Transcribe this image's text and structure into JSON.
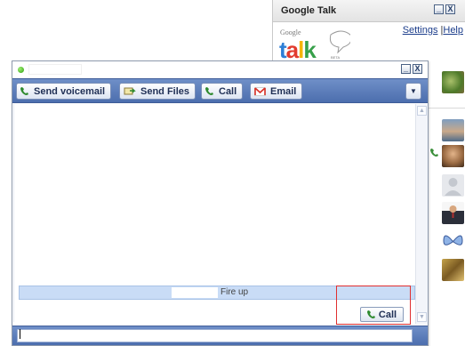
{
  "gtalk": {
    "title": "Google Talk",
    "settings_link": "Settings",
    "link_separator": " |",
    "help_link": "Help",
    "logo_text_google": "Google",
    "logo_text_talk": "talk",
    "logo_badge": "BETA",
    "accent": "#4c6eae"
  },
  "chat": {
    "toolbar": {
      "voicemail_label": "Send voicemail",
      "files_label": "Send Files",
      "call_label": "Call",
      "email_label": "Email",
      "menu_glyph": "▼"
    },
    "status_text": "Fire up",
    "call_button_label": "Call",
    "message_value": ""
  },
  "window_controls": {
    "minimize": "_",
    "close": "X"
  },
  "icons": [
    "phone-icon",
    "file-transfer-icon",
    "gmail-icon",
    "menu-arrow-icon",
    "status-dot-icon"
  ]
}
